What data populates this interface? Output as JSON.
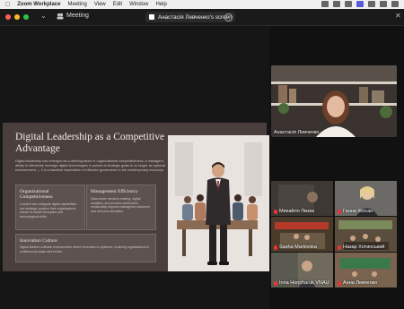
{
  "menubar": {
    "app": "Zoom Workplace",
    "items": [
      "Meeting",
      "View",
      "Edit",
      "Window",
      "Help"
    ]
  },
  "titlebar": {
    "meeting_label": "Meeting",
    "tab_label": "Анастасія Левченко's screen"
  },
  "slide": {
    "title": "Digital Leadership as a Competitive Advantage",
    "body": "Digital leadership has emerged as a defining factor in organizational competitiveness. A manager's ability to effectively leverage digital technologies in pursuit of strategic goals is no longer an optional enhancement — it is a baseline expectation of effective governance in the contemporary economy.",
    "cards": [
      {
        "title": "Organizational Competitiveness",
        "text": "Leaders who integrate digital capabilities into strategic position their organizations ahead of market disruption and technological shifts."
      },
      {
        "title": "Management Efficiency",
        "text": "Data-driven decision-making, digital analytics, and process automation measurably improve managerial outcomes and resource allocation."
      },
      {
        "title": "Innovation Culture",
        "text": "Digital leaders cultivate environments where innovation is systemic, enabling organizations to continuously adapt and evolve."
      }
    ]
  },
  "speaker": {
    "name": "Анастасія Левченко"
  },
  "participants": [
    {
      "name": "Михайло Лизак",
      "muted": true,
      "bg": "#3d3833"
    },
    {
      "name": "Ганна Жосан",
      "muted": true,
      "bg": "#6b6a66"
    },
    {
      "name": "Sasha Markivska",
      "muted": true,
      "bg": "#4a3a2a"
    },
    {
      "name": "Назар Хотинський",
      "muted": true,
      "bg": "#5a4d3e"
    },
    {
      "name": "Inna Honcharuk VNAU",
      "muted": true,
      "bg": "#6f6a5c"
    },
    {
      "name": "Анна Левченко",
      "muted": true,
      "bg": "#7a6450"
    }
  ],
  "colors": {
    "slide_bg": "#4a3f3c",
    "accent": "#5b5bd6"
  }
}
